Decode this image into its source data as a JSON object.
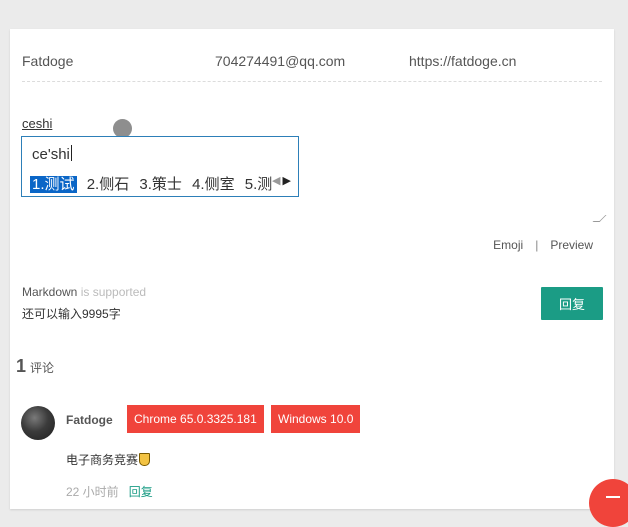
{
  "form": {
    "nick": "Fatdoge",
    "mail": "704274491@qq.com",
    "link": "https://fatdoge.cn"
  },
  "editor": {
    "text": "ceshi"
  },
  "ime": {
    "composition": "ce'shi",
    "candidates": [
      "1.测试",
      "2.侧石",
      "3.策士",
      "4.侧室",
      "5.测"
    ],
    "selected_index": 0
  },
  "tools": {
    "emoji": "Emoji",
    "separator": "|",
    "preview": "Preview"
  },
  "markdown": {
    "label": "Markdown",
    "supported": " is supported"
  },
  "remaining": "还可以输入9995字",
  "submit_label": "回复",
  "comments": {
    "count": "1",
    "word": "评论",
    "items": [
      {
        "nick": "Fatdoge",
        "browser": "Chrome 65.0.3325.181",
        "os": "Windows 10.0",
        "text": "电子商务竞赛",
        "time": "22 小时前",
        "reply": "回复"
      }
    ]
  },
  "colors": {
    "accent": "#1b9c85",
    "badge": "#f0443b",
    "ime_border": "#2d7fb8",
    "ime_selected": "#0a66c7"
  }
}
